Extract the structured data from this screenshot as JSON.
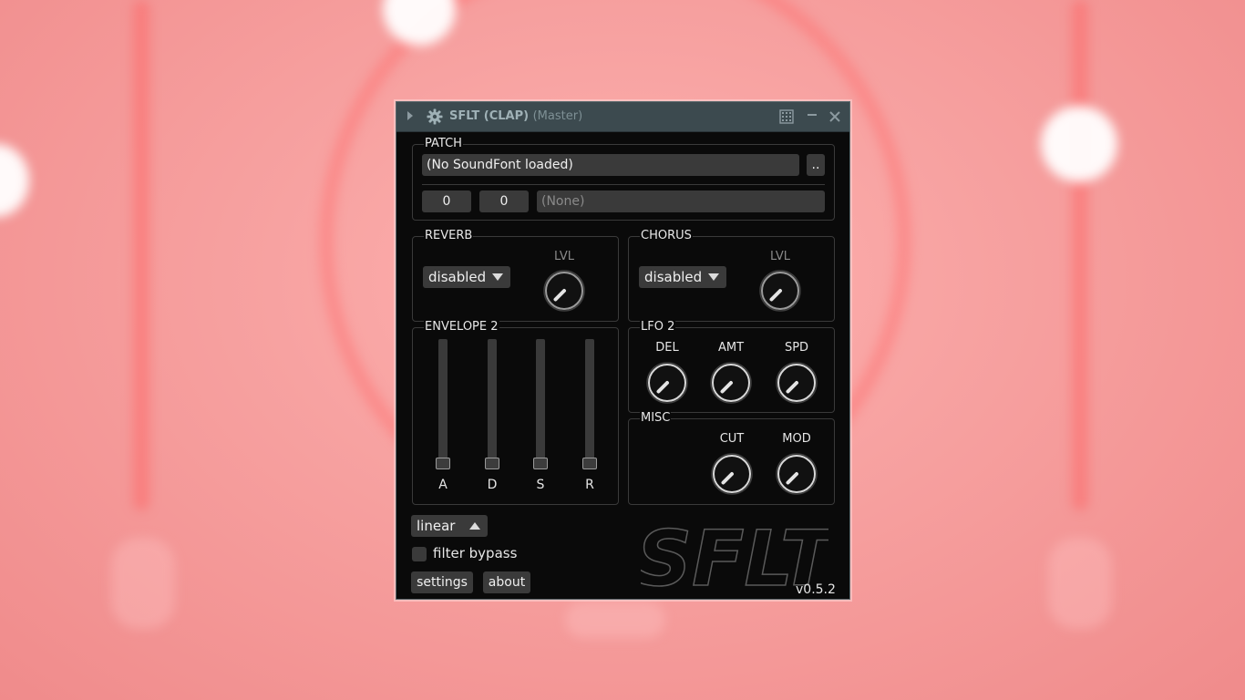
{
  "window": {
    "title": "SFLT (CLAP)",
    "subtitle": "(Master)"
  },
  "patch": {
    "label": "PATCH",
    "soundfont": "(No SoundFont loaded)",
    "browse_label": "..",
    "bank": "0",
    "program": "0",
    "preset_name": "(None)"
  },
  "reverb": {
    "label": "REVERB",
    "mode": "disabled",
    "level_label": "LVL"
  },
  "chorus": {
    "label": "CHORUS",
    "mode": "disabled",
    "level_label": "LVL"
  },
  "envelope": {
    "label": "ENVELOPE 2",
    "sliders": [
      {
        "label": "A",
        "value": 0.0
      },
      {
        "label": "D",
        "value": 0.0
      },
      {
        "label": "S",
        "value": 0.0
      },
      {
        "label": "R",
        "value": 0.0
      }
    ]
  },
  "lfo": {
    "label": "LFO 2",
    "knobs": [
      {
        "label": "DEL"
      },
      {
        "label": "AMT"
      },
      {
        "label": "SPD"
      }
    ]
  },
  "misc": {
    "label": "MISC",
    "knobs": [
      {
        "label": "CUT"
      },
      {
        "label": "MOD"
      }
    ]
  },
  "footer": {
    "curve": "linear",
    "filter_bypass_label": "filter bypass",
    "filter_bypass_checked": false,
    "settings_label": "settings",
    "about_label": "about",
    "logo_text": "SFLT",
    "version": "v0.5.2"
  },
  "colors": {
    "accent": "#3c4a4f",
    "control_bg": "#3a3a3a",
    "background": "#0a0a0a"
  },
  "icons": {
    "title_gear": "gear-icon",
    "expand": "triangle-right-icon",
    "keyboard": "grid-icon",
    "minimize": "minimize-icon",
    "close": "close-icon"
  }
}
